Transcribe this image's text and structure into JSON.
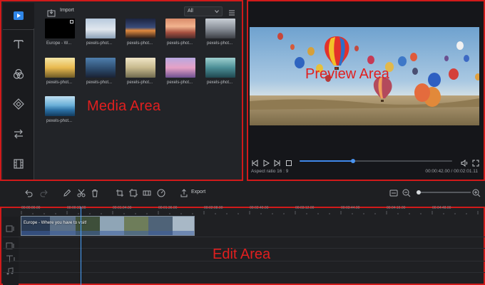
{
  "media": {
    "import_label": "Import",
    "filter": "All",
    "watermark": "Media Area",
    "items": [
      {
        "label": "Europe - W..."
      },
      {
        "label": "pexels-phot..."
      },
      {
        "label": "pexels-phot..."
      },
      {
        "label": "pexels-phot..."
      },
      {
        "label": "pexels-phot..."
      },
      {
        "label": "pexels-phot..."
      },
      {
        "label": "pexels-phot..."
      },
      {
        "label": "pexels-phot..."
      },
      {
        "label": "pexels-phot..."
      },
      {
        "label": "pexels-phot..."
      },
      {
        "label": "pexels-phot..."
      }
    ],
    "rail": [
      "media-icon",
      "text-icon",
      "effects-icon",
      "overlay-icon",
      "transition-icon",
      "film-icon"
    ]
  },
  "preview": {
    "watermark": "Preview Area",
    "aspect_ratio": "Aspect ratio   16 : 9",
    "timecode": "00:00:42.00 / 00:02:01.11",
    "progress": 0.35
  },
  "edit": {
    "export_label": "Export",
    "watermark": "Edit Area",
    "clip_title": "Europe - Where you have to visit!",
    "zoom": 0.0,
    "ruler": [
      "00:00:00.00",
      "00:00:32.00",
      "00:01:04.00",
      "00:01:36.00",
      "00:02:08.00",
      "00:02:40.00",
      "00:03:12.00",
      "00:03:44.00",
      "00:04:16.00",
      "00:04:48.00"
    ]
  },
  "colors": {
    "accent": "#3f88ea",
    "annotation": "#e11f1f"
  }
}
